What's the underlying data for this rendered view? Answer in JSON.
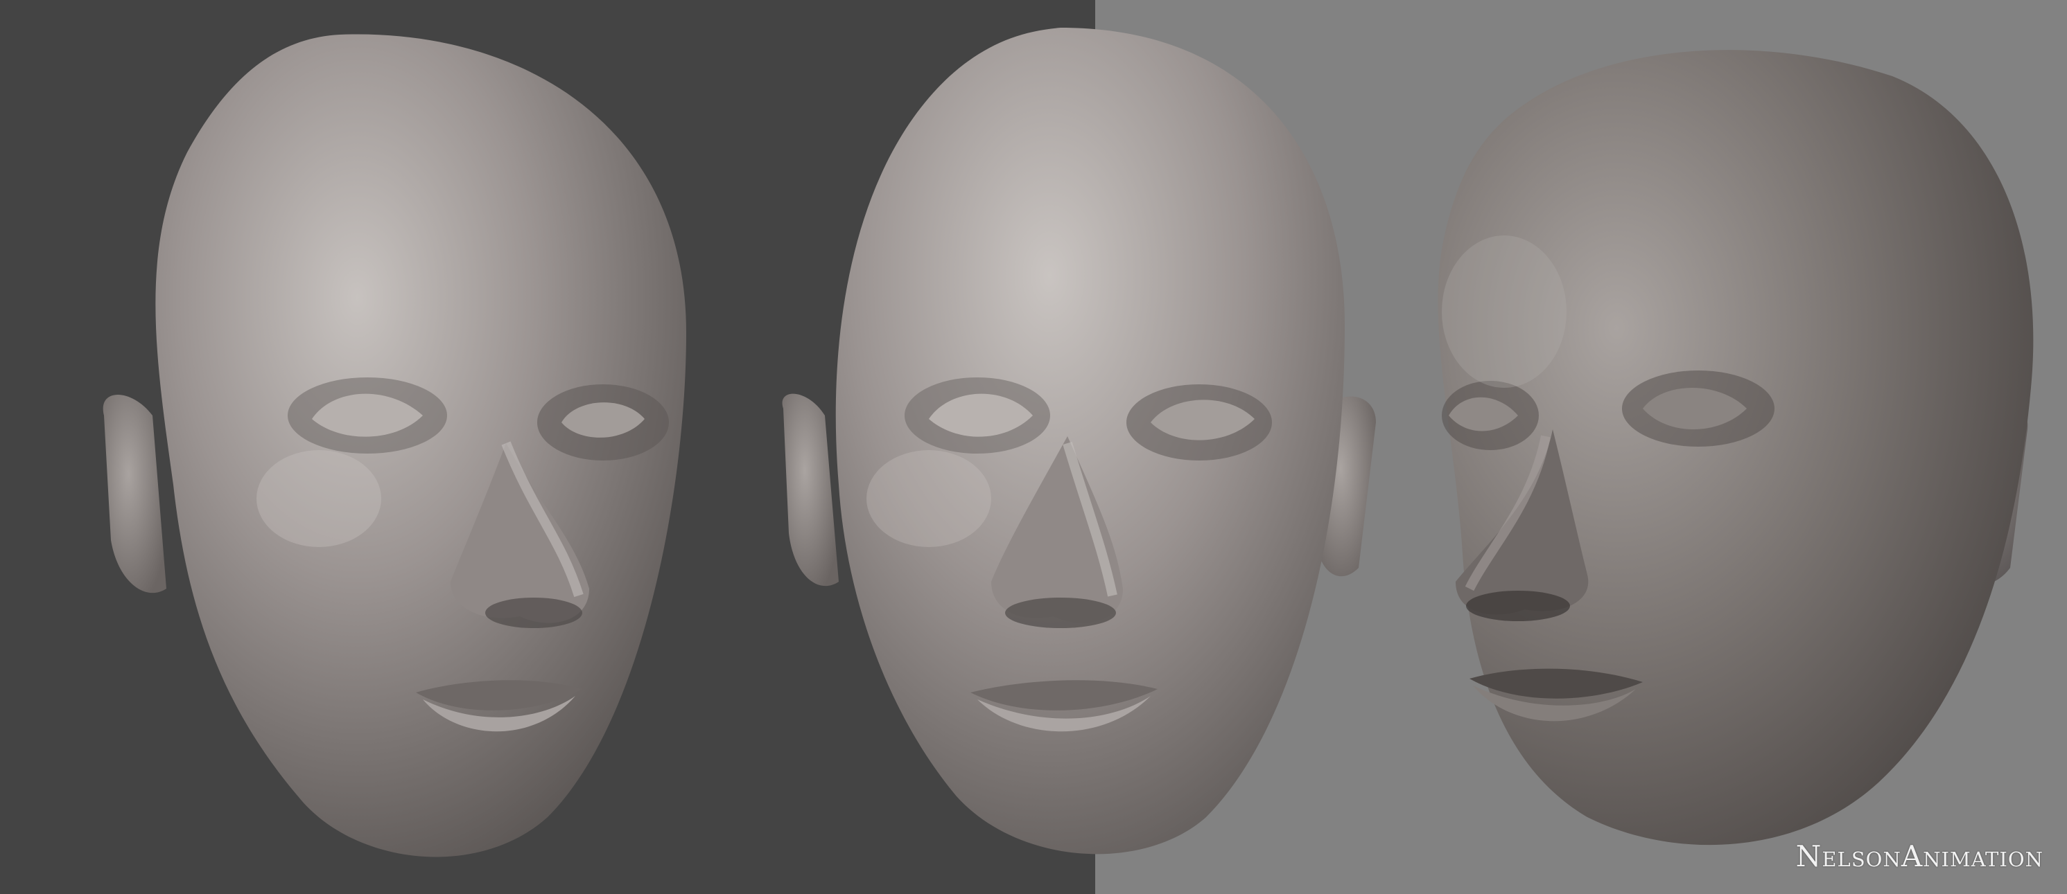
{
  "scene": {
    "background_left": "#444444",
    "background_right": "#828282",
    "skin_base": "#8f8886",
    "skin_highlight": "#c7c2bf",
    "skin_shadow": "#4a4543"
  },
  "renders": [
    {
      "view": "three-quarter-left"
    },
    {
      "view": "front"
    },
    {
      "view": "three-quarter-right"
    }
  ],
  "watermark": "NelsonAnimation"
}
